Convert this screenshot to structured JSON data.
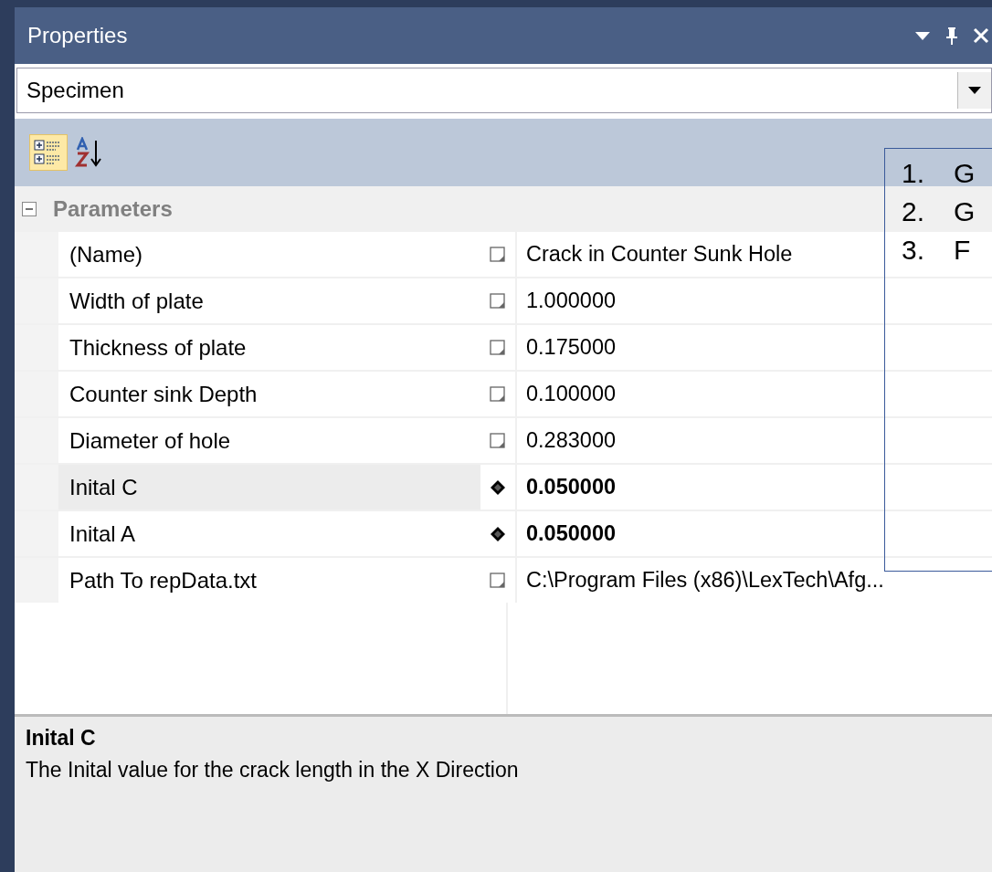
{
  "window": {
    "title": "Properties"
  },
  "object_selector": {
    "value": "Specimen"
  },
  "toolbar": [
    {
      "kind": "categorized",
      "selected": true
    },
    {
      "kind": "alphabetical",
      "selected": false
    }
  ],
  "category": {
    "name": "Parameters",
    "expanded": true
  },
  "properties": [
    {
      "name": "(Name)",
      "value": "Crack in Counter Sunk Hole",
      "modified": false,
      "selected": false
    },
    {
      "name": "Width of plate",
      "value": "1.000000",
      "modified": false,
      "selected": false
    },
    {
      "name": "Thickness of plate",
      "value": "0.175000",
      "modified": false,
      "selected": false
    },
    {
      "name": "Counter sink Depth",
      "value": "0.100000",
      "modified": false,
      "selected": false
    },
    {
      "name": "Diameter of hole",
      "value": "0.283000",
      "modified": false,
      "selected": false
    },
    {
      "name": "Inital C",
      "value": "0.050000",
      "modified": true,
      "selected": true
    },
    {
      "name": "Inital A",
      "value": "0.050000",
      "modified": true,
      "selected": false
    },
    {
      "name": "Path To repData.txt",
      "value": "C:\\Program Files (x86)\\LexTech\\Afg...",
      "modified": false,
      "selected": false
    }
  ],
  "description": {
    "title": "Inital C",
    "text": "The Inital value for the crack length in the X Direction"
  },
  "overlay_list": [
    {
      "number": "1.",
      "text": "G"
    },
    {
      "number": "2.",
      "text": "G"
    },
    {
      "number": "3.",
      "text": "F"
    }
  ]
}
